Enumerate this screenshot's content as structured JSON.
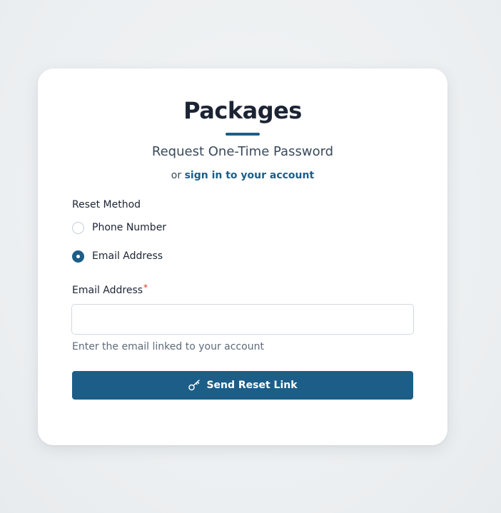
{
  "brand": {
    "name": "Packages"
  },
  "header": {
    "subtitle": "Request One-Time Password",
    "alt_prefix": "or",
    "alt_link": "sign in to your account"
  },
  "reset_method": {
    "label": "Reset Method",
    "options": [
      {
        "label": "Phone Number",
        "selected": false
      },
      {
        "label": "Email Address",
        "selected": true
      }
    ]
  },
  "email_field": {
    "label": "Email Address",
    "required_mark": "*",
    "value": "",
    "placeholder": "",
    "hint": "Enter the email linked to your account"
  },
  "submit": {
    "label": "Send Reset Link",
    "icon": "key-icon"
  },
  "colors": {
    "accent": "#1c5e88",
    "background": "#eef1f3",
    "card": "#ffffff",
    "required": "#d23a2a"
  }
}
